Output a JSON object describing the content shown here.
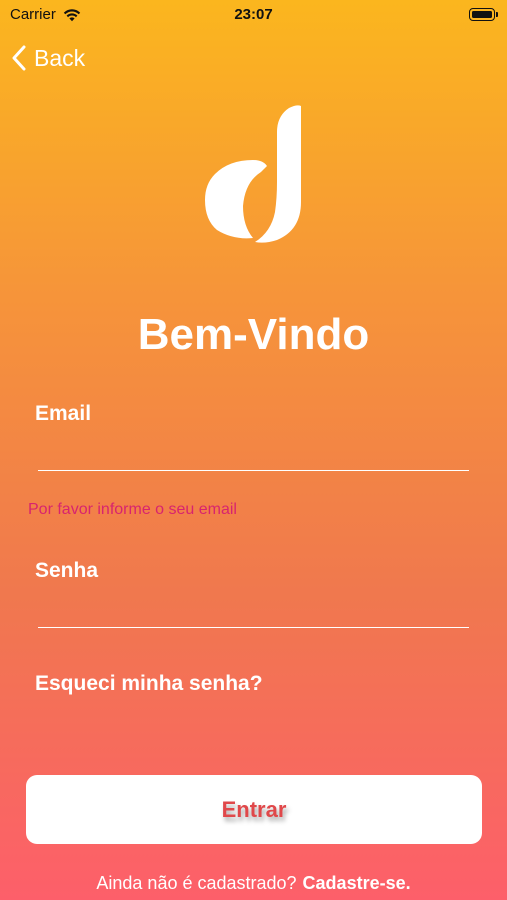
{
  "status_bar": {
    "carrier": "Carrier",
    "time": "23:07"
  },
  "nav": {
    "back_label": "Back"
  },
  "header": {
    "welcome": "Bem-Vindo"
  },
  "form": {
    "email_label": "Email",
    "email_value": "",
    "email_error": "Por favor informe o seu email",
    "password_label": "Senha",
    "password_value": "",
    "forgot_password": "Esqueci minha senha?",
    "submit_label": "Entrar"
  },
  "footer": {
    "prompt": "Ainda não é cadastrado?",
    "signup_link": "Cadastre-se."
  },
  "colors": {
    "gradient_top": "#fbb61e",
    "gradient_bottom": "#fd5f6a",
    "error": "#d8246e",
    "button_text": "#e0484a",
    "button_bg": "#ffffff"
  },
  "icons": [
    "wifi-icon",
    "battery-icon",
    "chevron-left-icon",
    "app-logo"
  ]
}
